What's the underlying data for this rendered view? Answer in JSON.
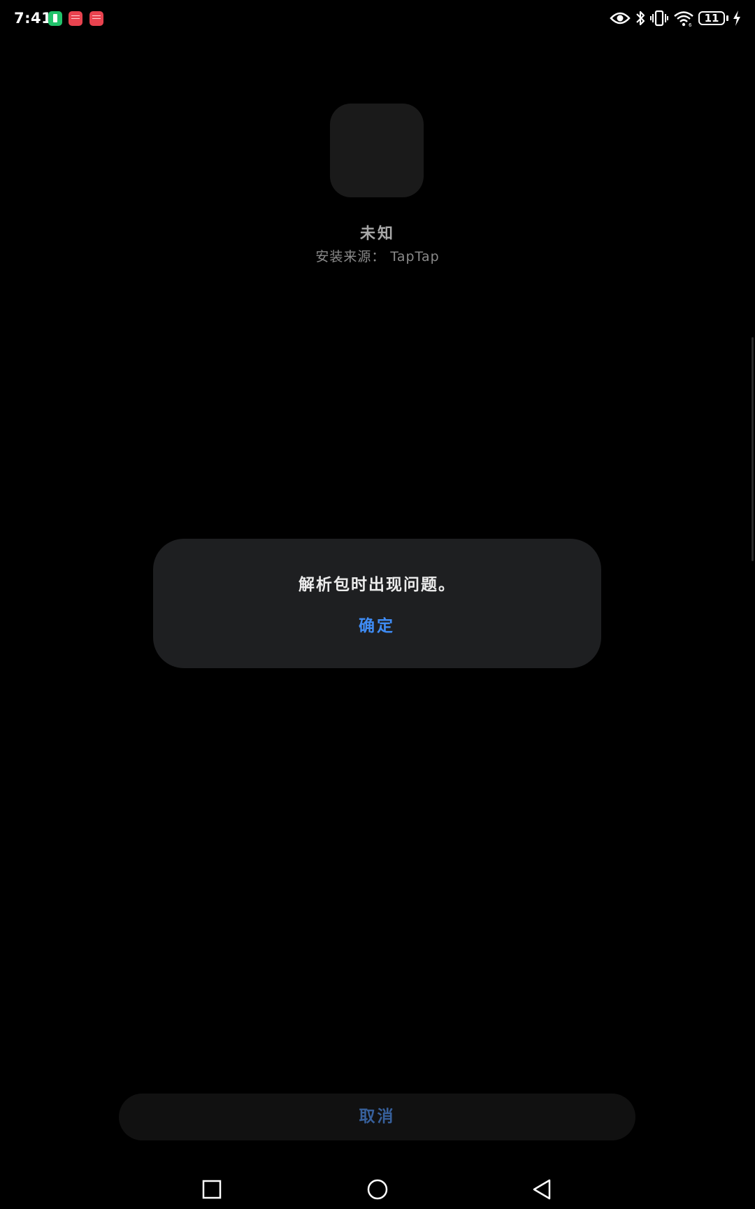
{
  "status_bar": {
    "time": "7:41",
    "battery_level": "11",
    "notification_icons": [
      "battery-app-icon",
      "red-app-icon",
      "red-app-icon"
    ],
    "system_icons": [
      "eye-icon",
      "bluetooth-icon",
      "vibrate-icon",
      "wifi-icon",
      "battery-icon",
      "charging-icon"
    ]
  },
  "app": {
    "name": "未知",
    "install_source": "安装来源： TapTap"
  },
  "dialog": {
    "message": "解析包时出现问题。",
    "confirm_label": "确定"
  },
  "footer": {
    "cancel_label": "取消"
  },
  "nav_bar": {
    "icons": [
      "recent-apps-icon",
      "home-icon",
      "back-icon"
    ]
  },
  "colors": {
    "background": "#000000",
    "dialog_background": "#1e1f21",
    "accent": "#3f8cf5",
    "cancel_text": "#37609b"
  }
}
